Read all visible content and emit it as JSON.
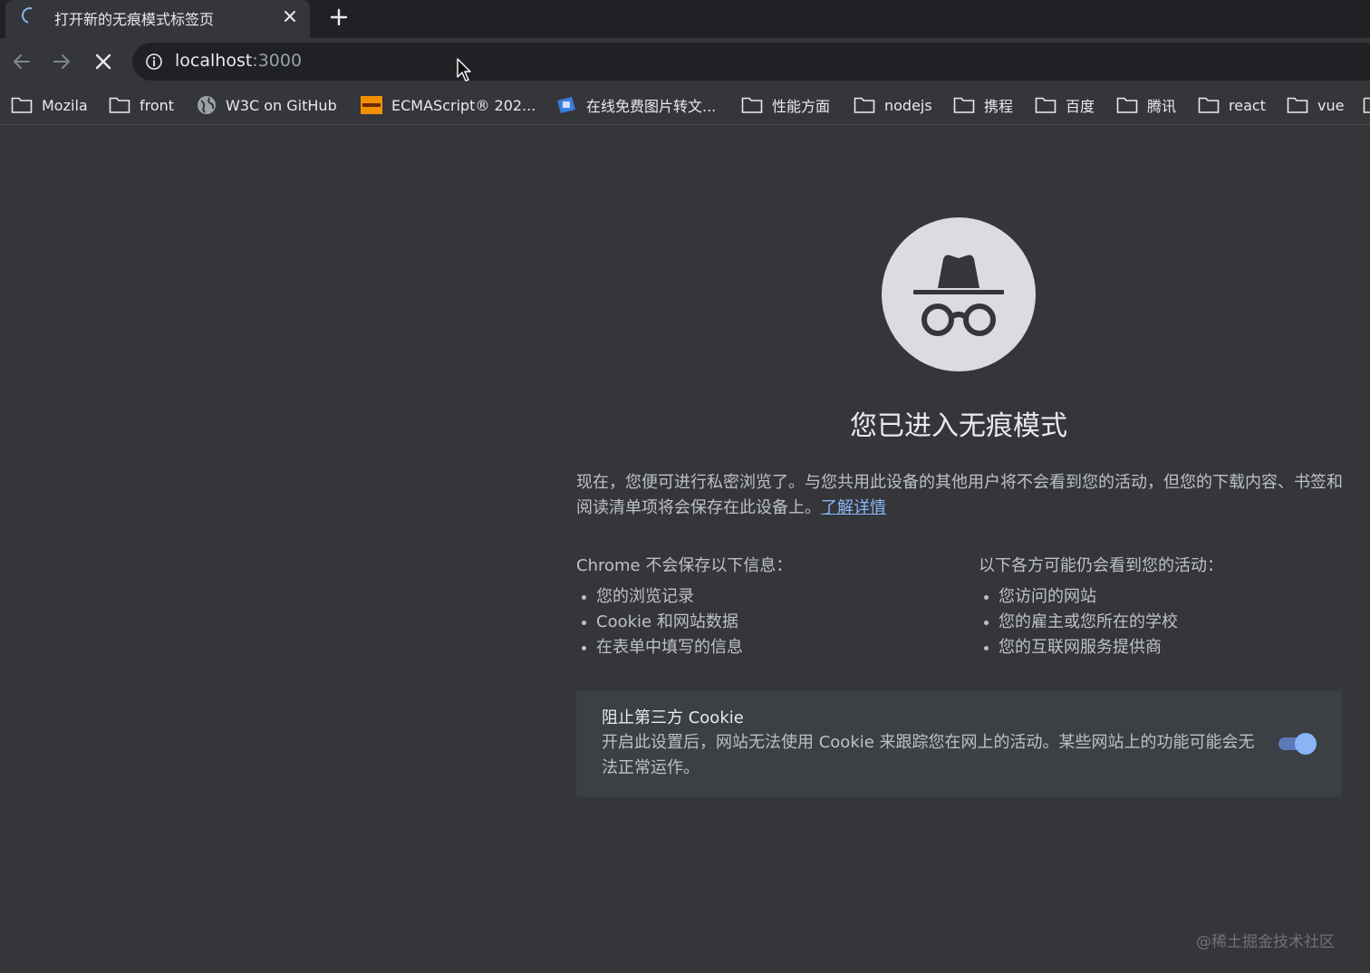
{
  "browser": {
    "tab": {
      "title": "打开新的无痕模式标签页"
    },
    "address": {
      "host": "localhost",
      "port": ":3000"
    }
  },
  "bookmarks": [
    {
      "label": "Mozila",
      "icon": "folder-icon"
    },
    {
      "label": "front",
      "icon": "folder-icon"
    },
    {
      "label": "W3C on GitHub",
      "icon": "globe-icon"
    },
    {
      "label": "ECMAScript® 202...",
      "icon": "ecma-favicon"
    },
    {
      "label": "在线免费图片转文...",
      "icon": "site-favicon"
    },
    {
      "label": "性能方面",
      "icon": "folder-icon"
    },
    {
      "label": "nodejs",
      "icon": "folder-icon"
    },
    {
      "label": "携程",
      "icon": "folder-icon"
    },
    {
      "label": "百度",
      "icon": "folder-icon"
    },
    {
      "label": "腾讯",
      "icon": "folder-icon"
    },
    {
      "label": "react",
      "icon": "folder-icon"
    },
    {
      "label": "vue",
      "icon": "folder-icon"
    }
  ],
  "incognito": {
    "heading": "您已进入无痕模式",
    "intro": "现在，您便可进行私密浏览了。与您共用此设备的其他用户将不会看到您的活动，但您的下载内容、书签和阅读清单项将会保存在此设备上。",
    "learn_more": "了解详情",
    "not_saved": {
      "title": "Chrome 不会保存以下信息：",
      "items": [
        "您的浏览记录",
        "Cookie 和网站数据",
        "在表单中填写的信息"
      ]
    },
    "visible_to": {
      "title": "以下各方可能仍会看到您的活动：",
      "items": [
        "您访问的网站",
        "您的雇主或您所在的学校",
        "您的互联网服务提供商"
      ]
    },
    "cookie_card": {
      "title": "阻止第三方 Cookie",
      "description": "开启此设置后，网站无法使用 Cookie 来跟踪您在网上的活动。某些网站上的功能可能会无法正常运作。",
      "enabled": true
    }
  },
  "watermark": "@稀土掘金技术社区",
  "colors": {
    "accent": "#8ab4f8",
    "background": "#35363a",
    "tabstrip": "#202124"
  }
}
